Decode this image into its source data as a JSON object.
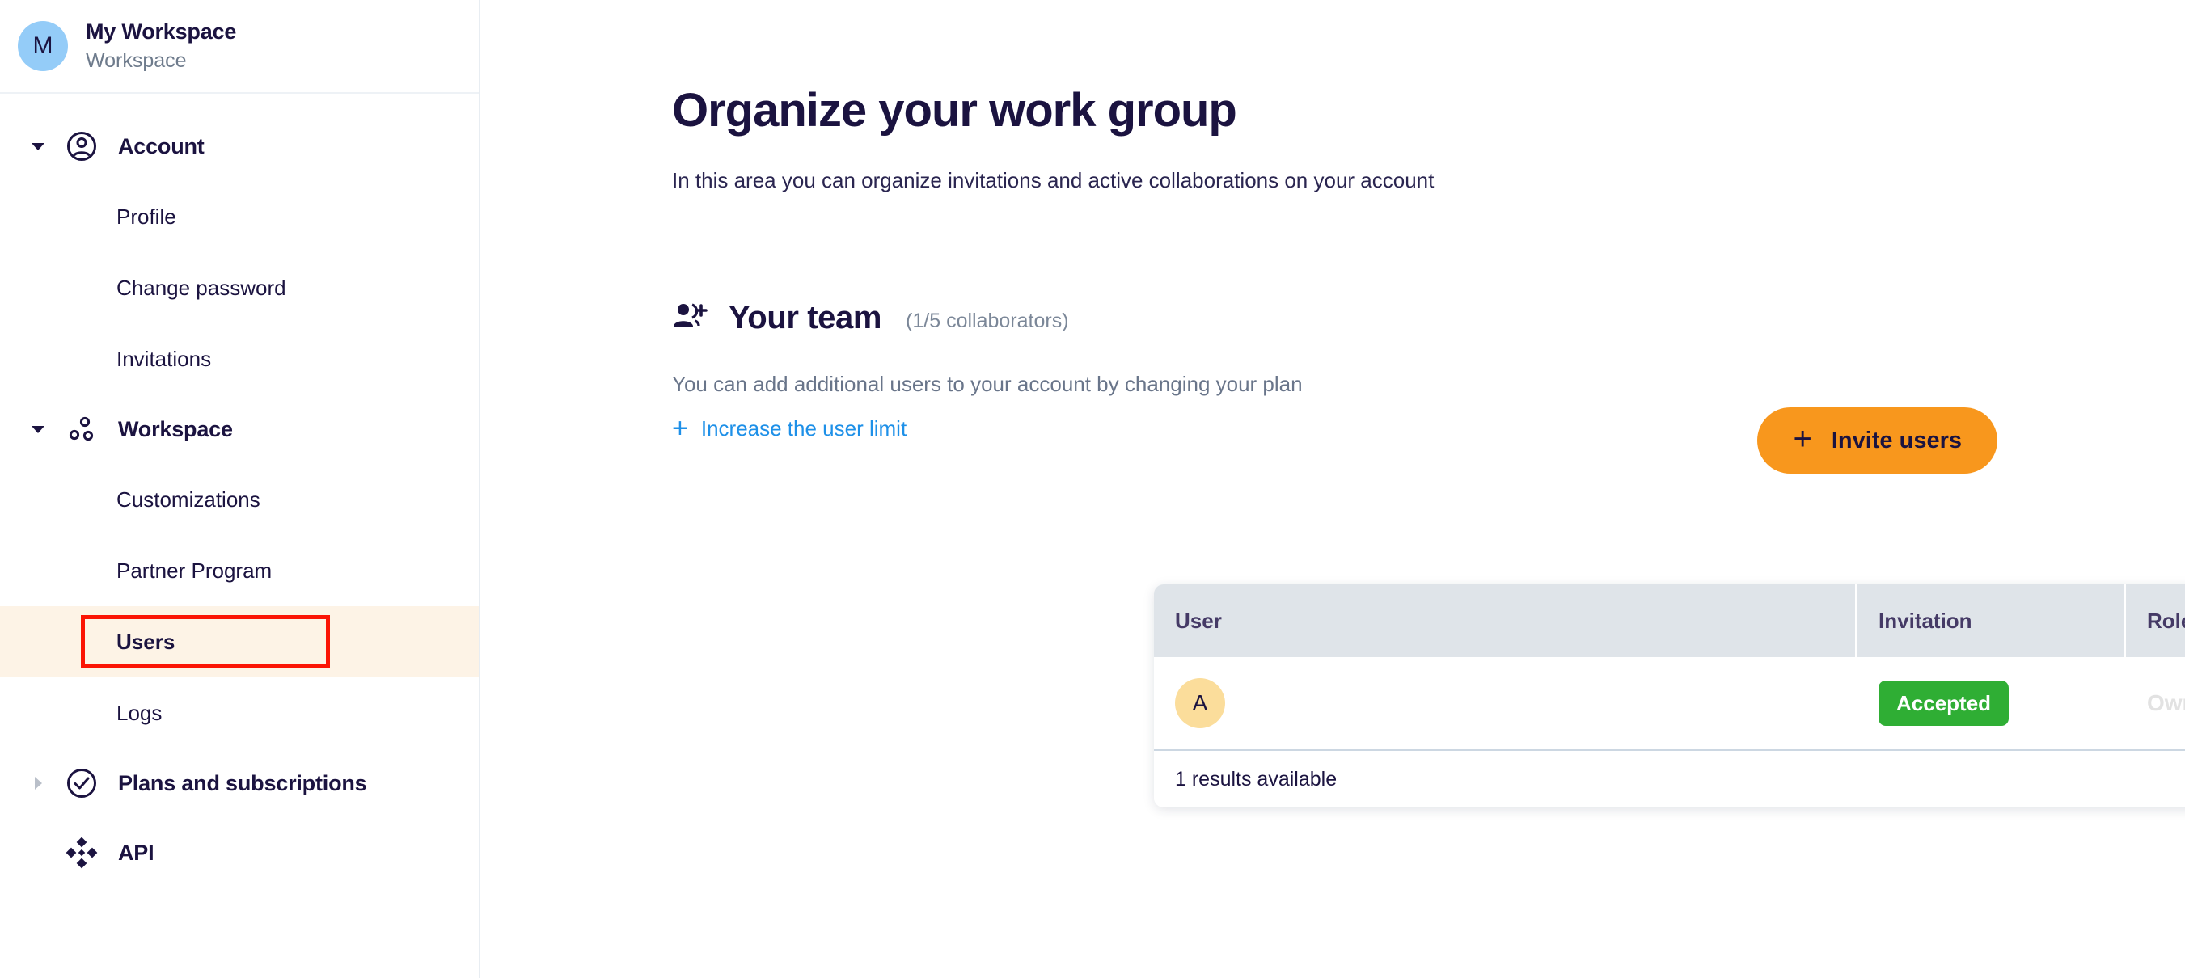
{
  "sidebar": {
    "workspace": {
      "avatar_initial": "M",
      "name": "My Workspace",
      "subtitle": "Workspace",
      "avatar_color": "#94ccf8"
    },
    "groups": [
      {
        "label": "Account",
        "icon": "user-circle-icon",
        "expanded": true,
        "caret": "chevron-down-icon",
        "items": [
          {
            "label": "Profile",
            "active": false
          },
          {
            "label": "Change password",
            "active": false
          },
          {
            "label": "Invitations",
            "active": false
          }
        ]
      },
      {
        "label": "Workspace",
        "icon": "nodes-icon",
        "expanded": true,
        "caret": "chevron-down-icon",
        "items": [
          {
            "label": "Customizations",
            "active": false
          },
          {
            "label": "Partner Program",
            "active": false
          },
          {
            "label": "Users",
            "active": true
          },
          {
            "label": "Logs",
            "active": false
          }
        ]
      },
      {
        "label": "Plans and subscriptions",
        "icon": "check-circle-icon",
        "expanded": false,
        "caret": "chevron-right-icon",
        "items": []
      },
      {
        "label": "API",
        "icon": "diamond-cluster-icon",
        "expanded": false,
        "caret": "",
        "items": []
      }
    ],
    "highlight_color": "#fdf3e6",
    "annotation_color": "#fb1405"
  },
  "main": {
    "title": "Organize your work group",
    "subtitle": "In this area you can organize invitations and active collaborations on your account",
    "team": {
      "icon": "person-add-icon",
      "title": "Your team",
      "count_label": "(1/5 collaborators)",
      "note": "You can add additional users to your account by changing your plan",
      "increase_limit_label": "Increase the user limit",
      "increase_limit_icon": "plus-icon",
      "link_color": "#1e90e8"
    },
    "invite_button": {
      "label": "Invite users",
      "icon": "plus-icon",
      "background": "#f8971d",
      "text_color": "#1b1340"
    },
    "table": {
      "columns": [
        "User",
        "Invitation",
        "Role",
        ""
      ],
      "rows": [
        {
          "avatar_initial": "A",
          "avatar_color": "#fbdd9b",
          "user_name": "",
          "invitation_status": "Accepted",
          "invitation_color": "#2fae34",
          "role": "Owner"
        }
      ],
      "footer": "1 results available",
      "header_background": "#dfe4e9"
    }
  }
}
